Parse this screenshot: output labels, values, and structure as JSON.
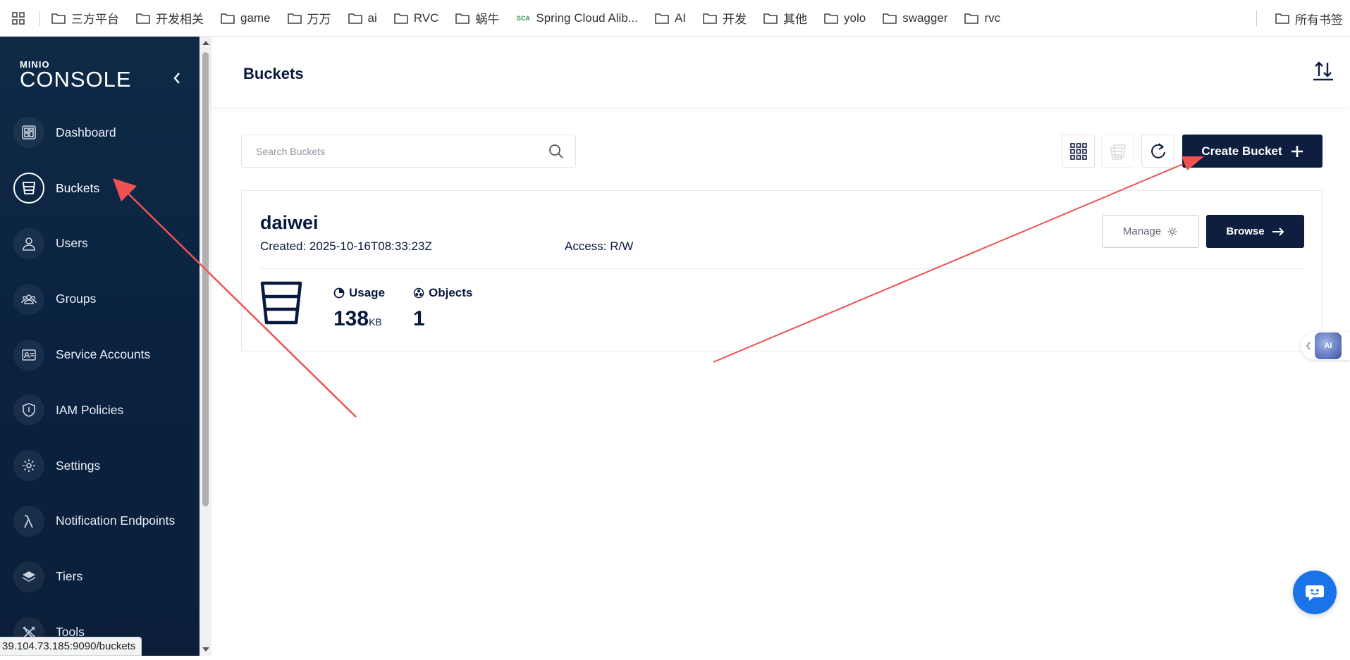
{
  "bookmarks": {
    "items": [
      {
        "label": "三方平台",
        "icon": "folder-icon"
      },
      {
        "label": "开发相关",
        "icon": "folder-icon"
      },
      {
        "label": "game",
        "icon": "folder-icon"
      },
      {
        "label": "万万",
        "icon": "folder-icon"
      },
      {
        "label": "ai",
        "icon": "folder-icon"
      },
      {
        "label": "RVC",
        "icon": "folder-icon"
      },
      {
        "label": "蜗牛",
        "icon": "folder-icon"
      },
      {
        "label": "Spring Cloud Alib...",
        "icon": "sca-icon",
        "icon_text": "SCA"
      },
      {
        "label": "AI",
        "icon": "folder-icon"
      },
      {
        "label": "开发",
        "icon": "folder-icon"
      },
      {
        "label": "其他",
        "icon": "folder-icon"
      },
      {
        "label": "yolo",
        "icon": "folder-icon"
      },
      {
        "label": "swagger",
        "icon": "folder-icon"
      },
      {
        "label": "rvc",
        "icon": "folder-icon"
      }
    ],
    "all_bookmarks": "所有书签"
  },
  "logo": {
    "minio": "MINIO",
    "console": "CONSOLE"
  },
  "sidebar": {
    "items": [
      {
        "label": "Dashboard",
        "icon": "dashboard-icon",
        "active": false
      },
      {
        "label": "Buckets",
        "icon": "bucket-icon",
        "active": true
      },
      {
        "label": "Users",
        "icon": "user-icon",
        "active": false
      },
      {
        "label": "Groups",
        "icon": "groups-icon",
        "active": false
      },
      {
        "label": "Service Accounts",
        "icon": "service-accounts-icon",
        "active": false
      },
      {
        "label": "IAM Policies",
        "icon": "shield-icon",
        "active": false
      },
      {
        "label": "Settings",
        "icon": "gear-icon",
        "active": false
      },
      {
        "label": "Notification Endpoints",
        "icon": "lambda-icon",
        "active": false
      },
      {
        "label": "Tiers",
        "icon": "layers-icon",
        "active": false
      },
      {
        "label": "Tools",
        "icon": "tools-icon",
        "active": false
      }
    ]
  },
  "header": {
    "title": "Buckets"
  },
  "toolbar": {
    "search_placeholder": "Search Buckets",
    "create_label": "Create Bucket"
  },
  "bucket": {
    "name": "daiwei",
    "created": "Created: 2025-10-16T08:33:23Z",
    "access": "Access: R/W",
    "manage_label": "Manage",
    "browse_label": "Browse",
    "usage_label": "Usage",
    "usage_value": "138",
    "usage_unit": "KB",
    "objects_label": "Objects",
    "objects_value": "1"
  },
  "floating": {
    "ai_label": "AI"
  },
  "status_url": "39.104.73.185:9090/buckets",
  "colors": {
    "sidebar": "#0e2a47",
    "primary": "#0d1e3f",
    "annotation": "#f05252",
    "chat": "#1a73e8"
  }
}
